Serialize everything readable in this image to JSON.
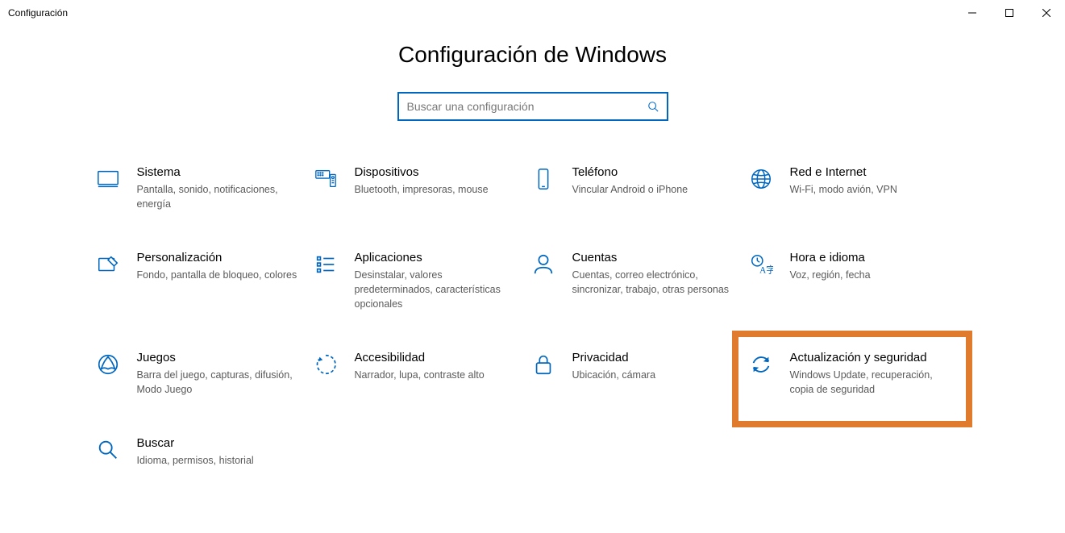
{
  "window": {
    "title": "Configuración"
  },
  "page": {
    "heading": "Configuración de Windows",
    "search_placeholder": "Buscar una configuración"
  },
  "tiles": [
    {
      "id": "sistema",
      "title": "Sistema",
      "desc": "Pantalla, sonido, notificaciones, energía"
    },
    {
      "id": "dispositivos",
      "title": "Dispositivos",
      "desc": "Bluetooth, impresoras, mouse"
    },
    {
      "id": "telefono",
      "title": "Teléfono",
      "desc": "Vincular Android o iPhone"
    },
    {
      "id": "red",
      "title": "Red e Internet",
      "desc": "Wi-Fi, modo avión, VPN"
    },
    {
      "id": "personalizacion",
      "title": "Personalización",
      "desc": "Fondo, pantalla de bloqueo, colores"
    },
    {
      "id": "aplicaciones",
      "title": "Aplicaciones",
      "desc": "Desinstalar, valores predeterminados, características opcionales"
    },
    {
      "id": "cuentas",
      "title": "Cuentas",
      "desc": "Cuentas, correo electrónico, sincronizar, trabajo, otras personas"
    },
    {
      "id": "hora",
      "title": "Hora e idioma",
      "desc": "Voz, región, fecha"
    },
    {
      "id": "juegos",
      "title": "Juegos",
      "desc": "Barra del juego, capturas, difusión, Modo Juego"
    },
    {
      "id": "accesibilidad",
      "title": "Accesibilidad",
      "desc": "Narrador, lupa, contraste alto"
    },
    {
      "id": "privacidad",
      "title": "Privacidad",
      "desc": "Ubicación, cámara"
    },
    {
      "id": "actualizacion",
      "title": "Actualización y seguridad",
      "desc": "Windows Update, recuperación, copia de seguridad",
      "highlighted": true
    },
    {
      "id": "buscar",
      "title": "Buscar",
      "desc": "Idioma, permisos, historial"
    }
  ],
  "highlight_color": "#e07b2e",
  "accent_color": "#0067c0"
}
